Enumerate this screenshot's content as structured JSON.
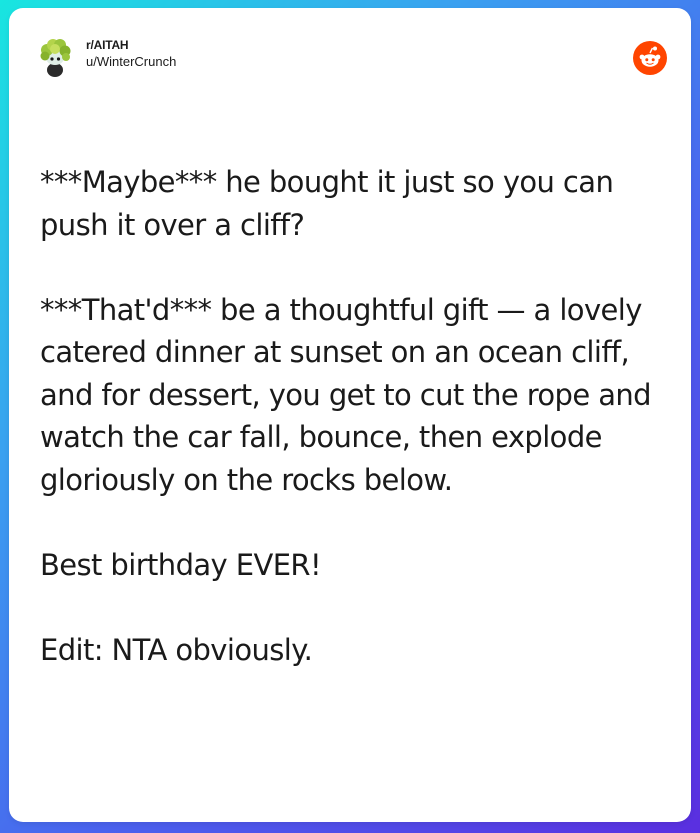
{
  "post": {
    "subreddit": "r/AITAH",
    "username": "u/WinterCrunch",
    "avatar_icon": "snoo-avatar-icon",
    "logo_icon": "reddit-logo-icon",
    "brand_color": "#ff4500",
    "paragraphs": [
      "***Maybe*** he bought it just so you can push it over a cliff?",
      "***That'd*** be a thoughtful gift — a lovely catered dinner at sunset on an ocean cliff, and for dessert, you get to cut the rope and watch the car fall, bounce, then explode gloriously on the rocks below.",
      "Best birthday EVER!",
      "Edit: NTA obviously."
    ]
  }
}
